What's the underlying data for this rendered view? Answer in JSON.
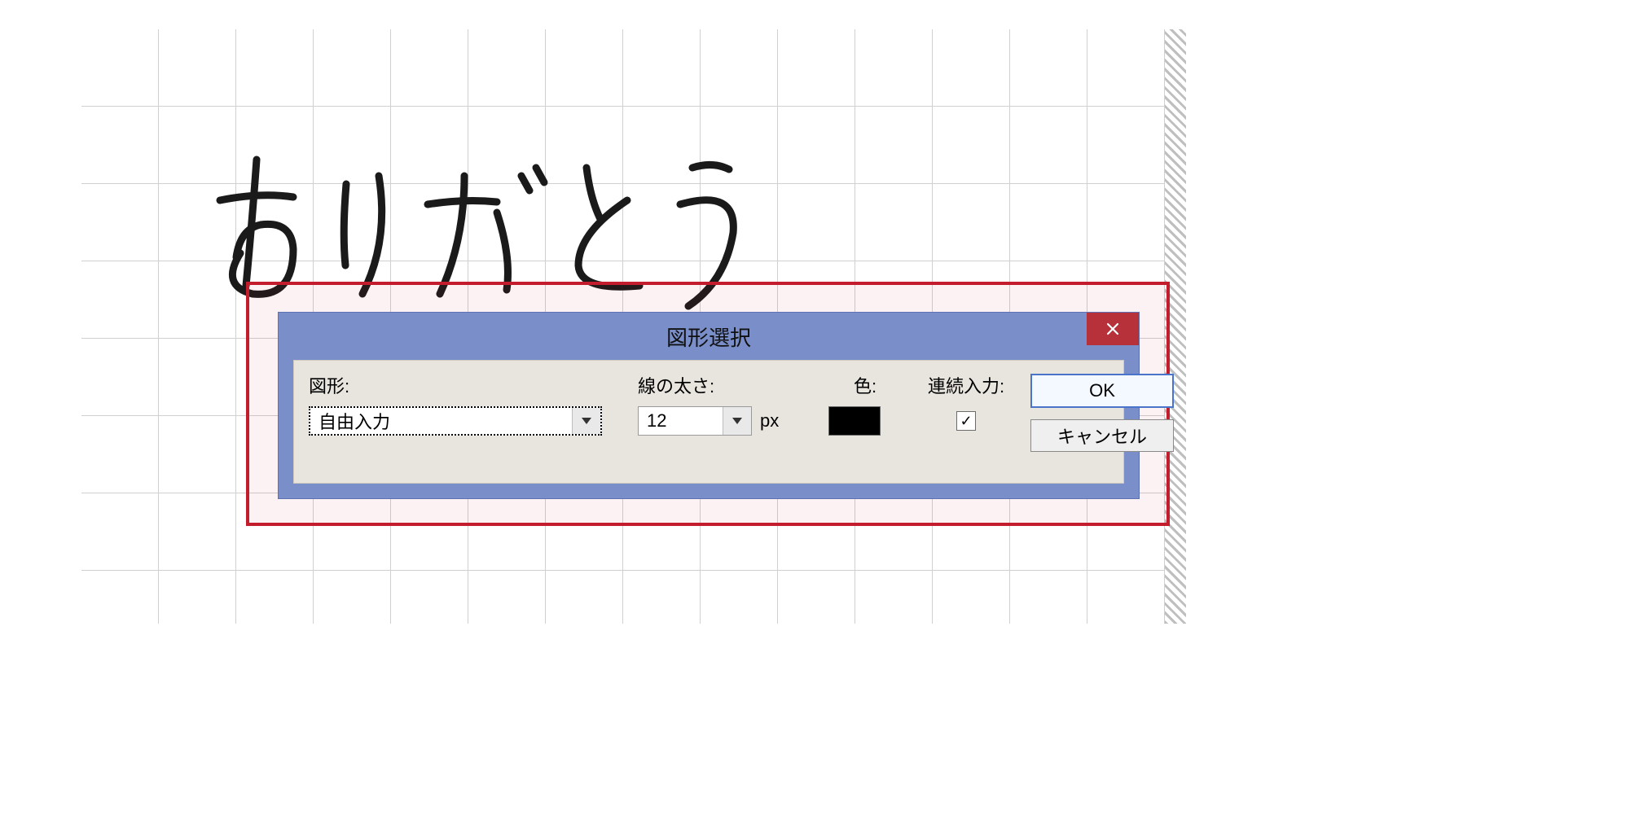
{
  "canvas": {
    "handwritten_text_meaning": "ありがとう"
  },
  "dialog": {
    "title": "図形選択",
    "close_icon": "close-icon",
    "labels": {
      "shape": "図形:",
      "line_width": "線の太さ:",
      "color": "色:",
      "continuous": "連続入力:",
      "px_suffix": "px"
    },
    "shape": {
      "selected": "自由入力"
    },
    "line_width": {
      "value": "12"
    },
    "color": {
      "value": "#000000"
    },
    "continuous_input": {
      "checked": true
    },
    "buttons": {
      "ok": "OK",
      "cancel": "キャンセル"
    }
  }
}
